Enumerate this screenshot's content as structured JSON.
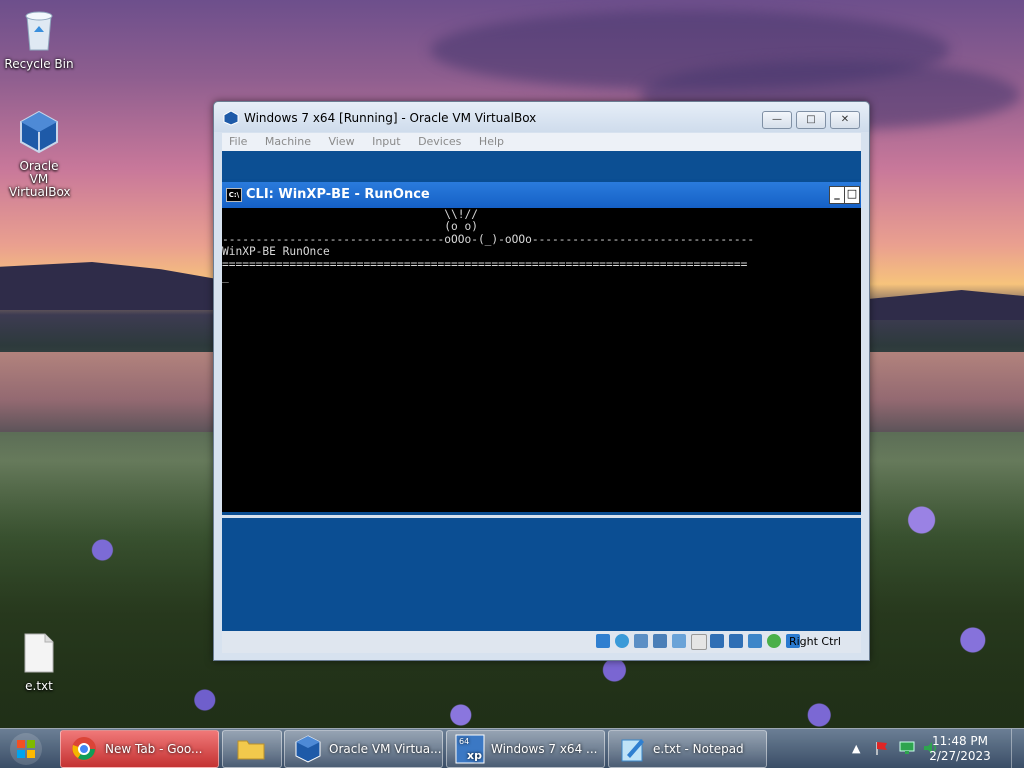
{
  "desktop": {
    "icons": [
      {
        "label": "Recycle Bin",
        "icon": "recycle-bin-icon"
      },
      {
        "label": "Oracle VM VirtualBox",
        "icon": "virtualbox-icon"
      },
      {
        "label": "e.txt",
        "icon": "text-file-icon"
      }
    ]
  },
  "vbox_window": {
    "title": "Windows 7 x64 [Running] - Oracle VM VirtualBox",
    "menu": [
      "File",
      "Machine",
      "View",
      "Input",
      "Devices",
      "Help"
    ],
    "status_hostkey": "Right Ctrl"
  },
  "cli_window": {
    "title": "CLI: WinXP-BE - RunOnce",
    "icon_text": "C:\\",
    "lines": [
      "                                 \\\\!//",
      "                                 (o o)",
      "---------------------------------oOOo-(_)-oOOo---------------------------------",
      "WinXP-BE RunOnce",
      "==============================================================================",
      "_"
    ]
  },
  "taskbar": {
    "items": [
      {
        "label": "New Tab - Goo...",
        "icon": "chrome-icon",
        "active": true
      },
      {
        "label": "",
        "icon": "folder-icon",
        "active": false
      },
      {
        "label": "Oracle VM Virtua...",
        "icon": "virtualbox-icon",
        "active": false
      },
      {
        "label": "Windows 7 x64 ...",
        "icon": "vm-xp-icon",
        "active": false
      },
      {
        "label": "e.txt - Notepad",
        "icon": "notepad-icon",
        "active": false
      }
    ],
    "clock": {
      "time": "11:48 PM",
      "date": "2/27/2023"
    }
  },
  "colors": {
    "vm_blue": "#0b4e93",
    "cli_title": "#1f6fd6",
    "taskbar_active": "#d94a4a"
  }
}
